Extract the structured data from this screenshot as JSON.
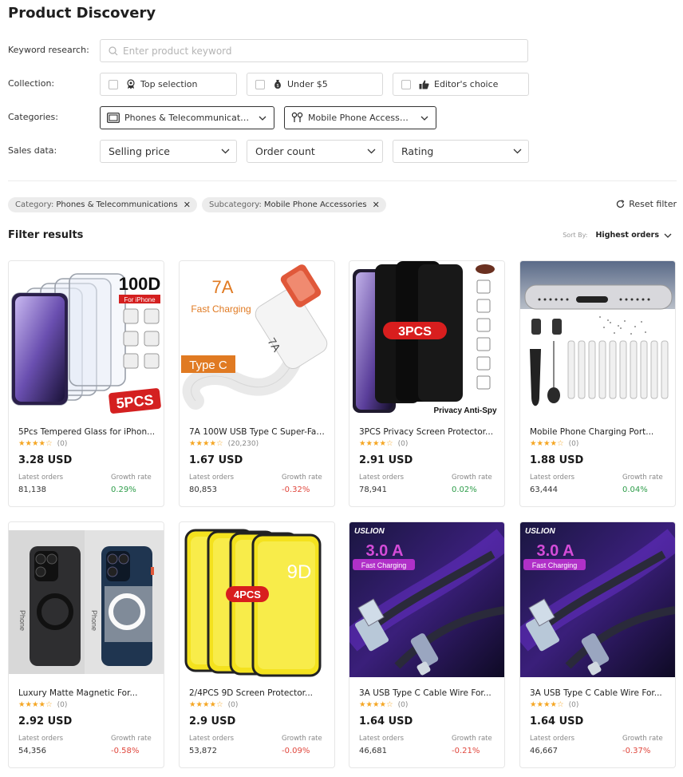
{
  "page": {
    "title": "Product Discovery"
  },
  "filters": {
    "keyword_label": "Keyword research:",
    "keyword_placeholder": "Enter product keyword",
    "collection_label": "Collection:",
    "collections": [
      {
        "label": "Top selection",
        "icon": "badge-icon"
      },
      {
        "label": "Under $5",
        "icon": "money-bag-icon"
      },
      {
        "label": "Editor's choice",
        "icon": "thumbs-up-icon"
      }
    ],
    "categories_label": "Categories:",
    "category": "Phones & Telecommunicatio...",
    "subcategory": "Mobile Phone Accessori...",
    "sales_label": "Sales data:",
    "sales_selects": [
      "Selling price",
      "Order count",
      "Rating"
    ]
  },
  "chips": [
    {
      "key": "Category:",
      "value": "Phones & Telecommunications"
    },
    {
      "key": "Subcategory:",
      "value": "Mobile Phone Accessories"
    }
  ],
  "reset_label": "Reset filter",
  "results": {
    "title": "Filter results",
    "sort_label": "Sort By:",
    "sort_value": "Highest orders",
    "latest_orders_label": "Latest orders",
    "growth_label": "Growth rate"
  },
  "products": [
    {
      "title": "5Pcs Tempered Glass for iPhon...",
      "rating": 4,
      "reviews": "(0)",
      "price": "3.28 USD",
      "orders": "81,138",
      "growth": "0.29%",
      "trend": "pos",
      "img": "glass"
    },
    {
      "title": "7A 100W USB Type C Super-Fas...",
      "rating": 4,
      "reviews": "(20,230)",
      "price": "1.67 USD",
      "orders": "80,853",
      "growth": "-0.32%",
      "trend": "neg",
      "img": "cable-white"
    },
    {
      "title": "3PCS Privacy Screen Protector...",
      "rating": 4,
      "reviews": "(0)",
      "price": "2.91 USD",
      "orders": "78,941",
      "growth": "0.02%",
      "trend": "pos",
      "img": "privacy"
    },
    {
      "title": "Mobile Phone Charging Port...",
      "rating": 4,
      "reviews": "(0)",
      "price": "1.88 USD",
      "orders": "63,444",
      "growth": "0.04%",
      "trend": "pos",
      "img": "port"
    },
    {
      "title": "Luxury Matte Magnetic For...",
      "rating": 4,
      "reviews": "(0)",
      "price": "2.92 USD",
      "orders": "54,356",
      "growth": "-0.58%",
      "trend": "neg",
      "img": "case"
    },
    {
      "title": "2/4PCS 9D Screen Protector...",
      "rating": 4,
      "reviews": "(0)",
      "price": "2.9 USD",
      "orders": "53,872",
      "growth": "-0.09%",
      "trend": "neg",
      "img": "yellow"
    },
    {
      "title": "3A USB Type C Cable Wire For...",
      "rating": 4,
      "reviews": "(0)",
      "price": "1.64 USD",
      "orders": "46,681",
      "growth": "-0.21%",
      "trend": "neg",
      "img": "usb"
    },
    {
      "title": "3A USB Type C Cable Wire For...",
      "rating": 4,
      "reviews": "(0)",
      "price": "1.64 USD",
      "orders": "46,667",
      "growth": "-0.37%",
      "trend": "neg",
      "img": "usb"
    }
  ],
  "image_text": {
    "glass_badge": "100D",
    "glass_sub": "For iPhone",
    "glass_pcs": "5PCS",
    "cable_7a": "7A",
    "cable_fast": "Fast Charging",
    "cable_typec": "Type C",
    "privacy_pcs": "3PCS",
    "privacy_caption": "Privacy Anti-Spy",
    "yellow_pcs": "4PCS",
    "yellow_9d": "9D",
    "usb_brand": "USLION",
    "usb_amp": "3.0 A",
    "usb_fast": "Fast Charging",
    "case_label": "Phone"
  }
}
